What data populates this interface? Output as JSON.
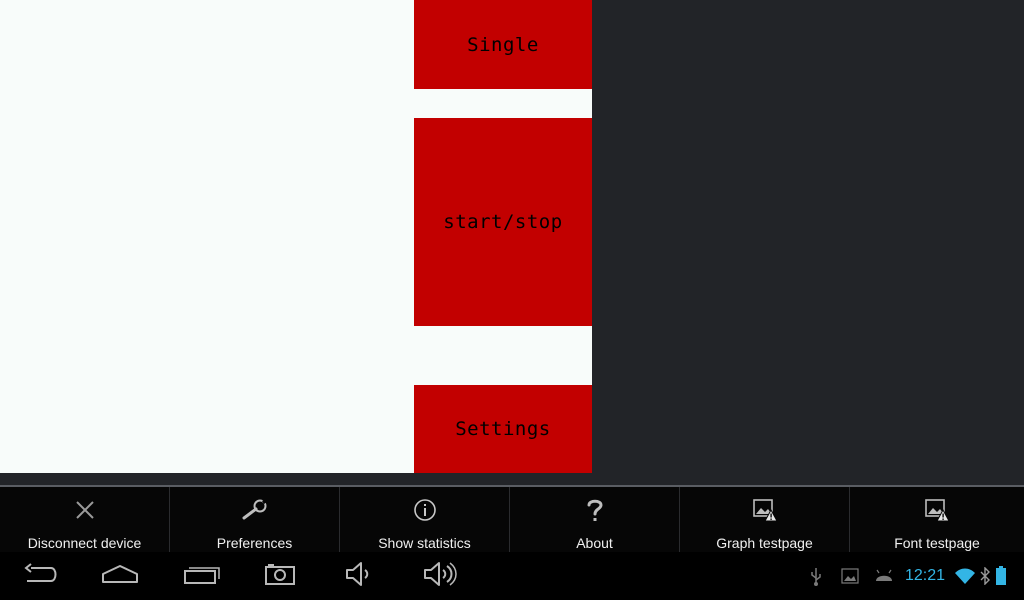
{
  "canvas": {
    "buttons": {
      "single": "Single",
      "start_stop": "start/stop",
      "settings": "Settings"
    },
    "colors": {
      "button_red": "#c20000",
      "canvas_bg": "#f8fcfa"
    }
  },
  "options_menu": {
    "items": [
      {
        "label": "Disconnect device",
        "icon": "close-icon"
      },
      {
        "label": "Preferences",
        "icon": "wrench-icon"
      },
      {
        "label": "Show statistics",
        "icon": "info-icon"
      },
      {
        "label": "About",
        "icon": "question-icon"
      },
      {
        "label": "Graph testpage",
        "icon": "image-warning-icon"
      },
      {
        "label": "Font testpage",
        "icon": "image-warning-icon"
      }
    ]
  },
  "nav_bar": {
    "buttons": [
      "back-icon",
      "home-icon",
      "recent-apps-icon",
      "screenshot-icon",
      "volume-down-icon",
      "volume-up-icon"
    ],
    "status": {
      "time": "12:21",
      "clock_color": "#33b5e5",
      "icons": [
        "usb-icon",
        "gallery-icon",
        "android-debug-icon",
        "wifi-icon",
        "bluetooth-icon",
        "battery-icon"
      ]
    }
  }
}
